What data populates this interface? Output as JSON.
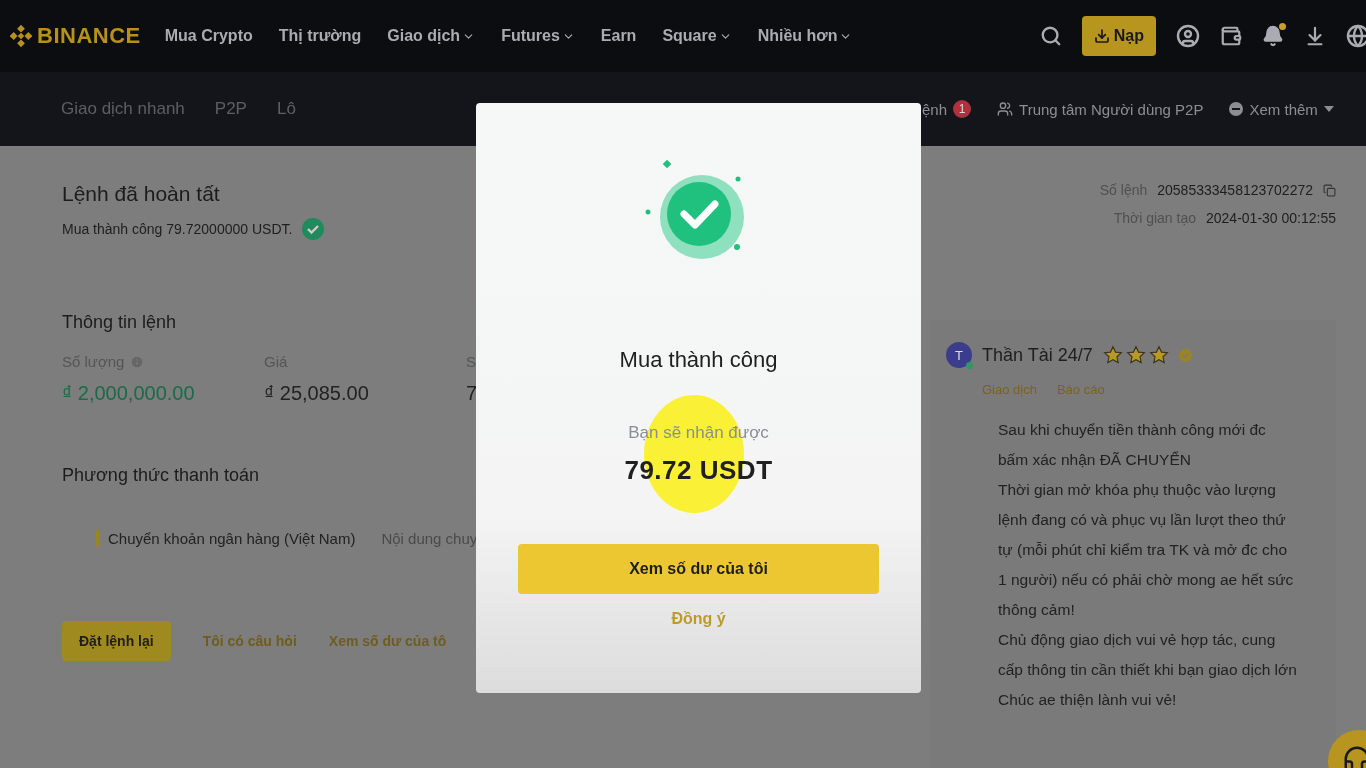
{
  "header": {
    "logo": "BINANCE",
    "deposit_button": "Nạp",
    "notification_dot": true,
    "nav": [
      {
        "label": "Mua Crypto",
        "dropdown": false
      },
      {
        "label": "Thị trường",
        "dropdown": false
      },
      {
        "label": "Giao dịch",
        "dropdown": true
      },
      {
        "label": "Futures",
        "dropdown": true
      },
      {
        "label": "Earn",
        "dropdown": false
      },
      {
        "label": "Square",
        "dropdown": true
      },
      {
        "label": "Nhiều hơn",
        "dropdown": true
      }
    ]
  },
  "subnav": {
    "left": [
      "Giao dịch nhanh",
      "P2P",
      "Lô"
    ],
    "right": [
      {
        "kind": "orders",
        "label": "ệnh",
        "badge": "1"
      },
      {
        "kind": "users",
        "label": "Trung tâm Người dùng P2P"
      },
      {
        "kind": "more",
        "label": "Xem thêm"
      }
    ]
  },
  "order": {
    "title": "Lệnh đã hoàn tất",
    "status": "Mua thành công 79.72000000 USDT.",
    "order_no_label": "Số lệnh",
    "order_no": "20585333458123702272",
    "created_label": "Thời gian tạo",
    "created": "2024-01-30 00:12:55"
  },
  "info": {
    "title": "Thông tin lệnh",
    "fields": [
      {
        "label": "Số lượng",
        "value": "₫ 2,000,000.00",
        "highlight": true,
        "info": true
      },
      {
        "label": "Giá",
        "value": "₫ 25,085.00",
        "highlight": false,
        "info": false
      },
      {
        "label": "S",
        "value": "7",
        "highlight": false
      }
    ]
  },
  "payment": {
    "title": "Phương thức thanh toán",
    "method": "Chuyển khoản ngân hàng (Việt Nam)",
    "note": "Nội dung chuy"
  },
  "actions": [
    {
      "label": "Đặt lệnh lại",
      "primary": true
    },
    {
      "label": "Tôi có câu hỏi",
      "primary": false
    },
    {
      "label": "Xem số dư của tô",
      "primary": false
    }
  ],
  "seller": {
    "avatar": "T",
    "name": "Thần Tài 24/7",
    "stars": 3,
    "verified": true,
    "online": true,
    "links": [
      "Giao dịch",
      "Báo cáo"
    ],
    "message": [
      "Sau khi chuyển tiền thành công mới đc bấm xác nhận ĐÃ CHUYỂN",
      "Thời gian mở khóa phụ thuộc vào lượng lệnh đang có và phục vụ lần lượt theo thứ tự (mỗi phút chỉ kiểm tra TK và mở đc cho 1 người) nếu có phải chờ mong ae hết sức thông cảm!",
      "Chủ động giao dịch vui vẻ hợp tác, cung cấp thông tin cần thiết khi bạn giao dịch lớn",
      "Chúc ae thiện lành vui vẻ!"
    ]
  },
  "modal": {
    "title": "Mua thành công",
    "label": "Bạn sẽ nhận được",
    "amount": "79.72 USDT",
    "primary_button": "Xem số dư của tôi",
    "secondary_button": "Đồng ý",
    "cursor_highlight": true
  }
}
